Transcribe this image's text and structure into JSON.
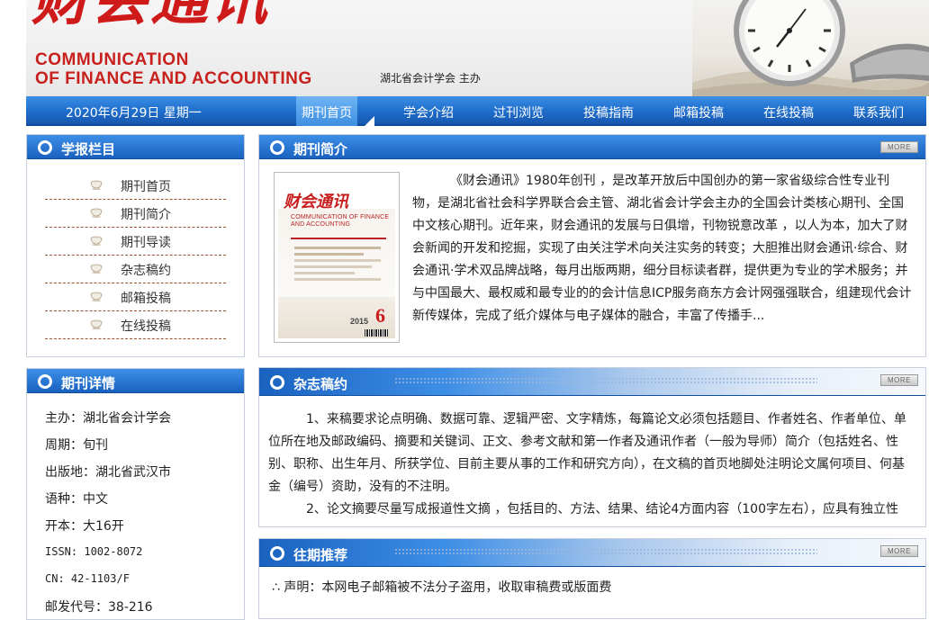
{
  "header": {
    "logo_cn": "财会通讯",
    "logo_en_line1": "COMMUNICATION",
    "logo_en_line2": "OF FINANCE AND ACCOUNTING",
    "sponsor": "湖北省会计学会 主办"
  },
  "nav": {
    "date": "2020年6月29日 星期一",
    "items": [
      "期刊首页",
      "学会介绍",
      "过刊浏览",
      "投稿指南",
      "邮箱投稿",
      "在线投稿",
      "联系我们"
    ]
  },
  "left_menu": {
    "title": "学报栏目",
    "items": [
      "期刊首页",
      "期刊简介",
      "期刊导读",
      "杂志稿约",
      "邮箱投稿",
      "在线投稿"
    ]
  },
  "details": {
    "title": "期刊详情",
    "rows": [
      "主办：湖北省会计学会",
      "周期：旬刊",
      "出版地：湖北省武汉市",
      "语种：中文",
      "开本：大16开",
      "ISSN: 1002-8072",
      "CN: 42-1103/F",
      "邮发代号：38-216"
    ]
  },
  "intro": {
    "title": "期刊简介",
    "more": "MORE",
    "cover_logo": "财会通讯",
    "cover_en": "COMMUNICATION OF FINANCE AND ACCOUNTING",
    "cover_issue": "2015",
    "cover_number": "6",
    "text": "《财会通讯》1980年创刊 ，是改革开放后中国创办的第一家省级综合性专业刊物，是湖北省社会科学界联合会主管、湖北省会计学会主办的全国会计类核心期刊、全国中文核心期刊。近年来，财会通讯的发展与日俱增，刊物锐意改革 ，以人为本，加大了财会新闻的开发和挖掘，实现了由关注学术向关注实务的转变；大胆推出财会通讯·综合、财会通讯·学术双品牌战略，每月出版两期，细分目标读者群，提供更为专业的学术服务；并与中国最大、最权威和最专业的的会计信息ICP服务商东方会计网强强联合，组建现代会计新传媒体，完成了纸介媒体与电子媒体的融合，丰富了传播手..."
  },
  "submission": {
    "title": "杂志稿约",
    "more": "MORE",
    "para1": "1、来稿要求论点明确、数据可靠、逻辑严密、文字精炼，每篇论文必须包括题目、作者姓名、作者单位、单位所在地及邮政编码、摘要和关键词、正文、参考文献和第一作者及通讯作者（一般为导师）简介（包括姓名、性别、职称、出生年月、所获学位、目前主要从事的工作和研究方向），在文稿的首页地脚处注明论文属何项目、何基金（编号）资助，没有的不注明。",
    "para2": "2、论文摘要尽量写成报道性文摘 ，包括目的、方法、结果、结论4方面内容（100字左右），应具有独立性"
  },
  "past": {
    "title": "往期推荐",
    "more": "MORE",
    "notice": "∴ 声明：本网电子邮箱被不法分子盗用，收取审稿费或版面费"
  }
}
